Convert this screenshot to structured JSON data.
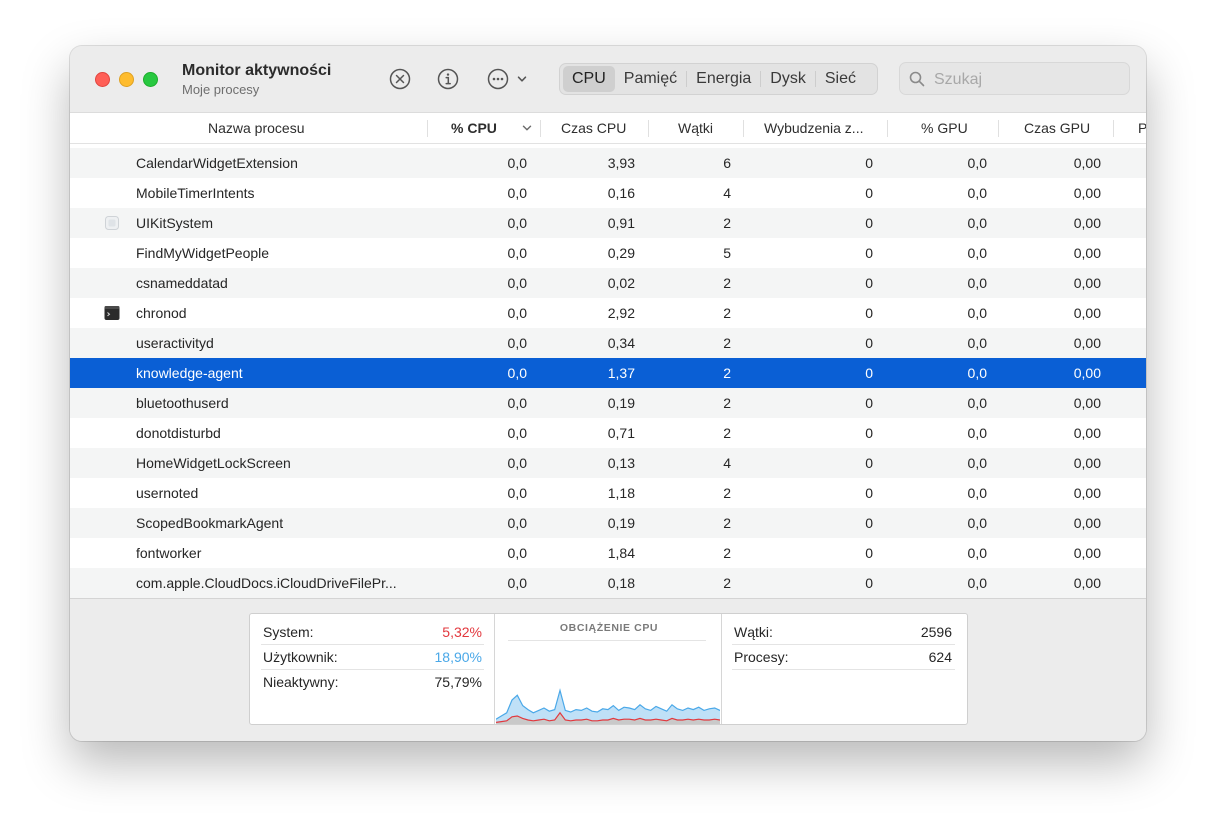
{
  "window": {
    "title": "Monitor aktywności",
    "subtitle": "Moje procesy"
  },
  "toolbar": {
    "icons": [
      "stop-process-icon",
      "info-icon",
      "more-actions-icon",
      "chevron-down-icon"
    ]
  },
  "tabs": [
    {
      "label": "CPU",
      "active": true
    },
    {
      "label": "Pamięć",
      "active": false
    },
    {
      "label": "Energia",
      "active": false
    },
    {
      "label": "Dysk",
      "active": false
    },
    {
      "label": "Sieć",
      "active": false
    }
  ],
  "search": {
    "placeholder": "Szukaj",
    "value": ""
  },
  "columns": [
    "Nazwa procesu",
    "% CPU",
    "Czas CPU",
    "Wątki",
    "Wybudzenia z...",
    "% GPU",
    "Czas GPU",
    "P"
  ],
  "sorted_column": "% CPU",
  "rows": [
    {
      "name": "CalendarWidgetExtension",
      "cpu": "0,0",
      "cpu_time": "3,93",
      "threads": "6",
      "wakeups": "0",
      "gpu": "0,0",
      "gpu_time": "0,00",
      "icon": ""
    },
    {
      "name": "MobileTimerIntents",
      "cpu": "0,0",
      "cpu_time": "0,16",
      "threads": "4",
      "wakeups": "0",
      "gpu": "0,0",
      "gpu_time": "0,00",
      "icon": ""
    },
    {
      "name": "UIKitSystem",
      "cpu": "0,0",
      "cpu_time": "0,91",
      "threads": "2",
      "wakeups": "0",
      "gpu": "0,0",
      "gpu_time": "0,00",
      "icon": "generic-app-icon"
    },
    {
      "name": "FindMyWidgetPeople",
      "cpu": "0,0",
      "cpu_time": "0,29",
      "threads": "5",
      "wakeups": "0",
      "gpu": "0,0",
      "gpu_time": "0,00",
      "icon": ""
    },
    {
      "name": "csnameddatad",
      "cpu": "0,0",
      "cpu_time": "0,02",
      "threads": "2",
      "wakeups": "0",
      "gpu": "0,0",
      "gpu_time": "0,00",
      "icon": ""
    },
    {
      "name": "chronod",
      "cpu": "0,0",
      "cpu_time": "2,92",
      "threads": "2",
      "wakeups": "0",
      "gpu": "0,0",
      "gpu_time": "0,00",
      "icon": "terminal-icon"
    },
    {
      "name": "useractivityd",
      "cpu": "0,0",
      "cpu_time": "0,34",
      "threads": "2",
      "wakeups": "0",
      "gpu": "0,0",
      "gpu_time": "0,00",
      "icon": ""
    },
    {
      "name": "knowledge-agent",
      "cpu": "0,0",
      "cpu_time": "1,37",
      "threads": "2",
      "wakeups": "0",
      "gpu": "0,0",
      "gpu_time": "0,00",
      "icon": "",
      "selected": true
    },
    {
      "name": "bluetoothuserd",
      "cpu": "0,0",
      "cpu_time": "0,19",
      "threads": "2",
      "wakeups": "0",
      "gpu": "0,0",
      "gpu_time": "0,00",
      "icon": ""
    },
    {
      "name": "donotdisturbd",
      "cpu": "0,0",
      "cpu_time": "0,71",
      "threads": "2",
      "wakeups": "0",
      "gpu": "0,0",
      "gpu_time": "0,00",
      "icon": ""
    },
    {
      "name": "HomeWidgetLockScreen",
      "cpu": "0,0",
      "cpu_time": "0,13",
      "threads": "4",
      "wakeups": "0",
      "gpu": "0,0",
      "gpu_time": "0,00",
      "icon": ""
    },
    {
      "name": "usernoted",
      "cpu": "0,0",
      "cpu_time": "1,18",
      "threads": "2",
      "wakeups": "0",
      "gpu": "0,0",
      "gpu_time": "0,00",
      "icon": ""
    },
    {
      "name": "ScopedBookmarkAgent",
      "cpu": "0,0",
      "cpu_time": "0,19",
      "threads": "2",
      "wakeups": "0",
      "gpu": "0,0",
      "gpu_time": "0,00",
      "icon": ""
    },
    {
      "name": "fontworker",
      "cpu": "0,0",
      "cpu_time": "1,84",
      "threads": "2",
      "wakeups": "0",
      "gpu": "0,0",
      "gpu_time": "0,00",
      "icon": ""
    },
    {
      "name": "com.apple.CloudDocs.iCloudDriveFilePr...",
      "cpu": "0,0",
      "cpu_time": "0,18",
      "threads": "2",
      "wakeups": "0",
      "gpu": "0,0",
      "gpu_time": "0,00",
      "icon": ""
    }
  ],
  "summary": {
    "system_label": "System:",
    "system_value": "5,32%",
    "user_label": "Użytkownik:",
    "user_value": "18,90%",
    "idle_label": "Nieaktywny:",
    "idle_value": "75,79%",
    "graph_title": "OBCIĄŻENIE CPU",
    "threads_label": "Wątki:",
    "threads_value": "2596",
    "processes_label": "Procesy:",
    "processes_value": "624"
  },
  "colors": {
    "selection": "#0a5fd5",
    "system": "#e2383e",
    "user": "#4aa8e8",
    "graph_user_fill": "#bfe0f7",
    "graph_system_fill": "#c9c9c9"
  },
  "chart_data": {
    "type": "area",
    "ylim": [
      0,
      100
    ],
    "series": [
      {
        "values": [
          6,
          10,
          14,
          30,
          36,
          23,
          18,
          14,
          17,
          20,
          16,
          18,
          42,
          17,
          15,
          18,
          17,
          20,
          16,
          15,
          19,
          18,
          23,
          17,
          21,
          20,
          18,
          24,
          19,
          17,
          22,
          19,
          16,
          24,
          19,
          17,
          20,
          18,
          21,
          17,
          19,
          20,
          17
        ]
      },
      {
        "values": [
          2,
          3,
          4,
          9,
          10,
          7,
          5,
          4,
          5,
          6,
          4,
          5,
          14,
          5,
          4,
          5,
          5,
          6,
          4,
          4,
          5,
          5,
          7,
          5,
          6,
          6,
          5,
          7,
          5,
          5,
          6,
          5,
          4,
          7,
          5,
          5,
          6,
          5,
          6,
          5,
          5,
          6,
          5
        ]
      }
    ]
  }
}
